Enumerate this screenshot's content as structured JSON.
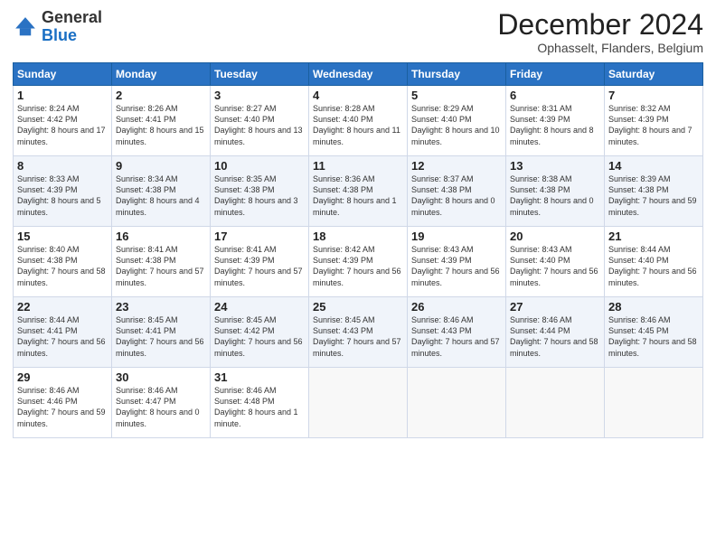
{
  "logo": {
    "general": "General",
    "blue": "Blue"
  },
  "header": {
    "month": "December 2024",
    "location": "Ophasselt, Flanders, Belgium"
  },
  "days": [
    "Sunday",
    "Monday",
    "Tuesday",
    "Wednesday",
    "Thursday",
    "Friday",
    "Saturday"
  ],
  "weeks": [
    [
      {
        "day": "1",
        "sunrise": "Sunrise: 8:24 AM",
        "sunset": "Sunset: 4:42 PM",
        "daylight": "Daylight: 8 hours and 17 minutes."
      },
      {
        "day": "2",
        "sunrise": "Sunrise: 8:26 AM",
        "sunset": "Sunset: 4:41 PM",
        "daylight": "Daylight: 8 hours and 15 minutes."
      },
      {
        "day": "3",
        "sunrise": "Sunrise: 8:27 AM",
        "sunset": "Sunset: 4:40 PM",
        "daylight": "Daylight: 8 hours and 13 minutes."
      },
      {
        "day": "4",
        "sunrise": "Sunrise: 8:28 AM",
        "sunset": "Sunset: 4:40 PM",
        "daylight": "Daylight: 8 hours and 11 minutes."
      },
      {
        "day": "5",
        "sunrise": "Sunrise: 8:29 AM",
        "sunset": "Sunset: 4:40 PM",
        "daylight": "Daylight: 8 hours and 10 minutes."
      },
      {
        "day": "6",
        "sunrise": "Sunrise: 8:31 AM",
        "sunset": "Sunset: 4:39 PM",
        "daylight": "Daylight: 8 hours and 8 minutes."
      },
      {
        "day": "7",
        "sunrise": "Sunrise: 8:32 AM",
        "sunset": "Sunset: 4:39 PM",
        "daylight": "Daylight: 8 hours and 7 minutes."
      }
    ],
    [
      {
        "day": "8",
        "sunrise": "Sunrise: 8:33 AM",
        "sunset": "Sunset: 4:39 PM",
        "daylight": "Daylight: 8 hours and 5 minutes."
      },
      {
        "day": "9",
        "sunrise": "Sunrise: 8:34 AM",
        "sunset": "Sunset: 4:38 PM",
        "daylight": "Daylight: 8 hours and 4 minutes."
      },
      {
        "day": "10",
        "sunrise": "Sunrise: 8:35 AM",
        "sunset": "Sunset: 4:38 PM",
        "daylight": "Daylight: 8 hours and 3 minutes."
      },
      {
        "day": "11",
        "sunrise": "Sunrise: 8:36 AM",
        "sunset": "Sunset: 4:38 PM",
        "daylight": "Daylight: 8 hours and 1 minute."
      },
      {
        "day": "12",
        "sunrise": "Sunrise: 8:37 AM",
        "sunset": "Sunset: 4:38 PM",
        "daylight": "Daylight: 8 hours and 0 minutes."
      },
      {
        "day": "13",
        "sunrise": "Sunrise: 8:38 AM",
        "sunset": "Sunset: 4:38 PM",
        "daylight": "Daylight: 8 hours and 0 minutes."
      },
      {
        "day": "14",
        "sunrise": "Sunrise: 8:39 AM",
        "sunset": "Sunset: 4:38 PM",
        "daylight": "Daylight: 7 hours and 59 minutes."
      }
    ],
    [
      {
        "day": "15",
        "sunrise": "Sunrise: 8:40 AM",
        "sunset": "Sunset: 4:38 PM",
        "daylight": "Daylight: 7 hours and 58 minutes."
      },
      {
        "day": "16",
        "sunrise": "Sunrise: 8:41 AM",
        "sunset": "Sunset: 4:38 PM",
        "daylight": "Daylight: 7 hours and 57 minutes."
      },
      {
        "day": "17",
        "sunrise": "Sunrise: 8:41 AM",
        "sunset": "Sunset: 4:39 PM",
        "daylight": "Daylight: 7 hours and 57 minutes."
      },
      {
        "day": "18",
        "sunrise": "Sunrise: 8:42 AM",
        "sunset": "Sunset: 4:39 PM",
        "daylight": "Daylight: 7 hours and 56 minutes."
      },
      {
        "day": "19",
        "sunrise": "Sunrise: 8:43 AM",
        "sunset": "Sunset: 4:39 PM",
        "daylight": "Daylight: 7 hours and 56 minutes."
      },
      {
        "day": "20",
        "sunrise": "Sunrise: 8:43 AM",
        "sunset": "Sunset: 4:40 PM",
        "daylight": "Daylight: 7 hours and 56 minutes."
      },
      {
        "day": "21",
        "sunrise": "Sunrise: 8:44 AM",
        "sunset": "Sunset: 4:40 PM",
        "daylight": "Daylight: 7 hours and 56 minutes."
      }
    ],
    [
      {
        "day": "22",
        "sunrise": "Sunrise: 8:44 AM",
        "sunset": "Sunset: 4:41 PM",
        "daylight": "Daylight: 7 hours and 56 minutes."
      },
      {
        "day": "23",
        "sunrise": "Sunrise: 8:45 AM",
        "sunset": "Sunset: 4:41 PM",
        "daylight": "Daylight: 7 hours and 56 minutes."
      },
      {
        "day": "24",
        "sunrise": "Sunrise: 8:45 AM",
        "sunset": "Sunset: 4:42 PM",
        "daylight": "Daylight: 7 hours and 56 minutes."
      },
      {
        "day": "25",
        "sunrise": "Sunrise: 8:45 AM",
        "sunset": "Sunset: 4:43 PM",
        "daylight": "Daylight: 7 hours and 57 minutes."
      },
      {
        "day": "26",
        "sunrise": "Sunrise: 8:46 AM",
        "sunset": "Sunset: 4:43 PM",
        "daylight": "Daylight: 7 hours and 57 minutes."
      },
      {
        "day": "27",
        "sunrise": "Sunrise: 8:46 AM",
        "sunset": "Sunset: 4:44 PM",
        "daylight": "Daylight: 7 hours and 58 minutes."
      },
      {
        "day": "28",
        "sunrise": "Sunrise: 8:46 AM",
        "sunset": "Sunset: 4:45 PM",
        "daylight": "Daylight: 7 hours and 58 minutes."
      }
    ],
    [
      {
        "day": "29",
        "sunrise": "Sunrise: 8:46 AM",
        "sunset": "Sunset: 4:46 PM",
        "daylight": "Daylight: 7 hours and 59 minutes."
      },
      {
        "day": "30",
        "sunrise": "Sunrise: 8:46 AM",
        "sunset": "Sunset: 4:47 PM",
        "daylight": "Daylight: 8 hours and 0 minutes."
      },
      {
        "day": "31",
        "sunrise": "Sunrise: 8:46 AM",
        "sunset": "Sunset: 4:48 PM",
        "daylight": "Daylight: 8 hours and 1 minute."
      },
      null,
      null,
      null,
      null
    ]
  ]
}
